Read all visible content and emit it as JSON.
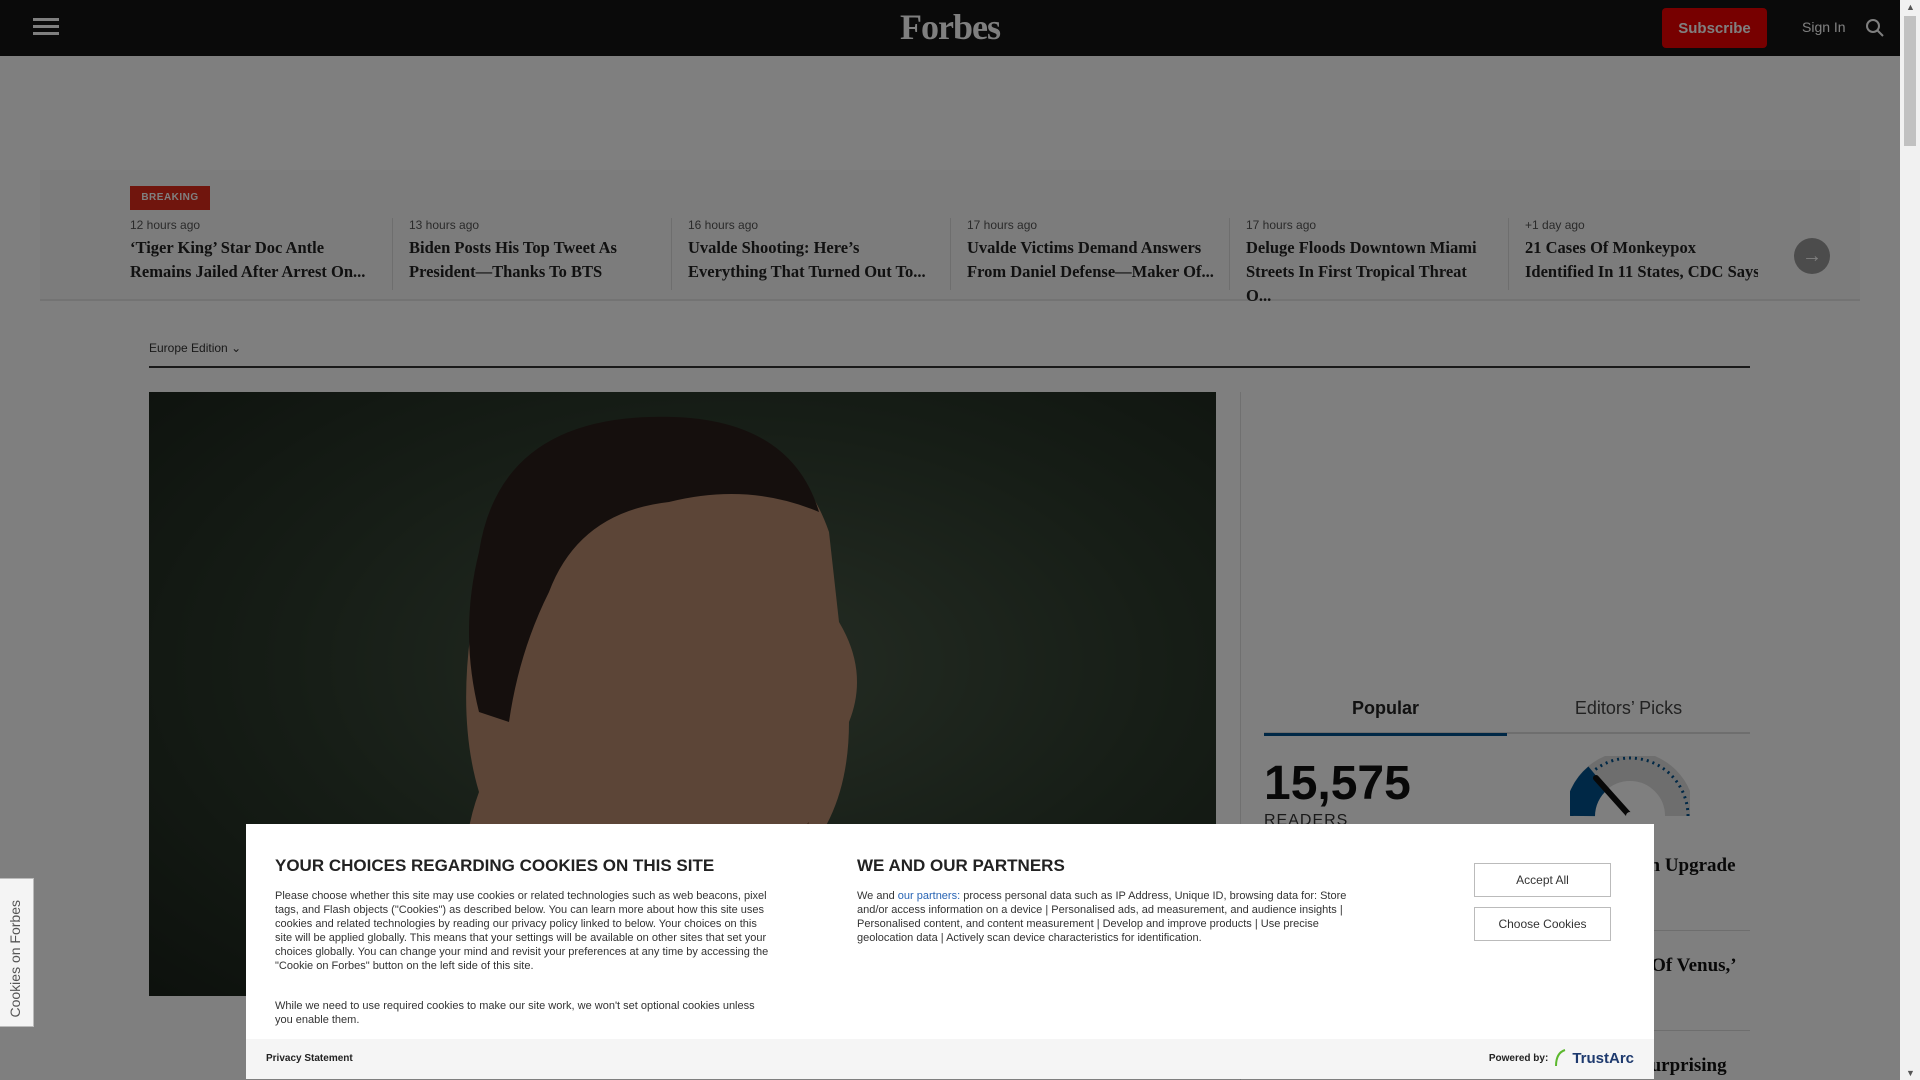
{
  "header": {
    "logo": "Forbes",
    "subscribe": "Subscribe",
    "sign_in": "Sign In"
  },
  "ticker": {
    "badge": "BREAKING",
    "items": [
      {
        "time": "12 hours ago",
        "title": "‘Tiger King’ Star Doc Antle Remains Jailed After Arrest On..."
      },
      {
        "time": "13 hours ago",
        "title": "Biden Posts His Top Tweet As President—Thanks To BTS"
      },
      {
        "time": "16 hours ago",
        "title": "Uvalde Shooting: Here’s Everything That Turned Out To..."
      },
      {
        "time": "17 hours ago",
        "title": "Uvalde Victims Demand Answers From Daniel Defense—Maker Of..."
      },
      {
        "time": "17 hours ago",
        "title": "Deluge Floods Downtown Miami Streets In First Tropical Threat O..."
      },
      {
        "time": "+1 day ago",
        "title": "21 Cases Of Monkeypox Identified In 11 States, CDC Says"
      }
    ]
  },
  "edition": "Europe Edition",
  "sidebar": {
    "tabs": [
      "Popular",
      "Editors’ Picks"
    ],
    "readers": "15,575",
    "readers_label": "READERS",
    "gauge_fraction": 0.35,
    "titles": [
      "gn Upgrade",
      "t Of Venus,’",
      "Surprising"
    ]
  },
  "cookie_tab": "Cookies on Forbes",
  "modal": {
    "left_heading": "YOUR CHOICES REGARDING COOKIES ON THIS SITE",
    "left_p1": "Please choose whether this site may use cookies or related technologies such as web beacons, pixel tags, and Flash objects (\"Cookies\") as described below. You can learn more about how this site uses cookies and related technologies by reading our privacy policy linked to below. Your choices on this site will be applied globally. This means that your settings will be available on other sites that set your choices globally. You can change your mind and revisit your preferences at any time by accessing the \"Cookie on Forbes\" button on the left side of this site.",
    "left_p2": "While we need to use required cookies to make our site work, we won't set optional cookies unless you enable them.",
    "right_heading": "WE AND OUR PARTNERS",
    "right_pre": "We and ",
    "right_link": "our partners:",
    "right_text": " process personal data such as IP Address, Unique ID, browsing data for: Store and/or access information on a device | Personalised ads, ad measurement, and audience insights | Personalised content, and content measurement | Develop and improve products | Use precise geolocation data | Actively scan device characteristics for identification.",
    "accept": "Accept All",
    "choose": "Choose Cookies",
    "privacy": "Privacy Statement",
    "powered": "Powered by:",
    "brand": "TrustArc"
  }
}
